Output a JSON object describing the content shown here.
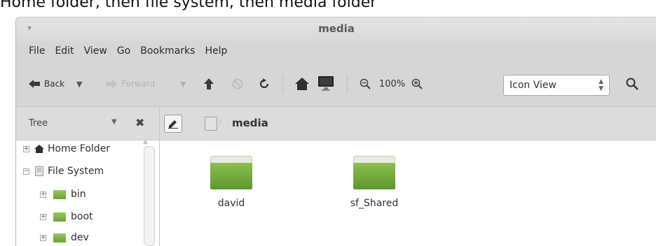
{
  "caption": "Home folder, then file system, then media folder",
  "window": {
    "title": "media",
    "menu_icon": "▾"
  },
  "menubar": [
    {
      "label": "File"
    },
    {
      "label": "Edit"
    },
    {
      "label": "View"
    },
    {
      "label": "Go"
    },
    {
      "label": "Bookmarks"
    },
    {
      "label": "Help"
    }
  ],
  "toolbar": {
    "back_label": "Back",
    "forward_label": "Forward",
    "zoom_level": "100%",
    "view_mode": "Icon View"
  },
  "sidebar": {
    "title": "Tree",
    "tree": [
      {
        "label": "Home Folder",
        "expander": "+",
        "icon": "home-icon",
        "depth": 0
      },
      {
        "label": "File System",
        "expander": "−",
        "icon": "drive-icon",
        "depth": 0
      },
      {
        "label": "bin",
        "expander": "+",
        "icon": "folder-icon",
        "depth": 1
      },
      {
        "label": "boot",
        "expander": "+",
        "icon": "folder-icon",
        "depth": 1
      },
      {
        "label": "dev",
        "expander": "+",
        "icon": "folder-icon",
        "depth": 1
      }
    ]
  },
  "pathbar": {
    "current": "media"
  },
  "files": [
    {
      "name": "david",
      "icon": "folder-icon"
    },
    {
      "name": "sf_Shared",
      "icon": "folder-icon"
    }
  ],
  "colors": {
    "folder_green": "#7cb342",
    "window_bg": "#d6d6d6"
  }
}
